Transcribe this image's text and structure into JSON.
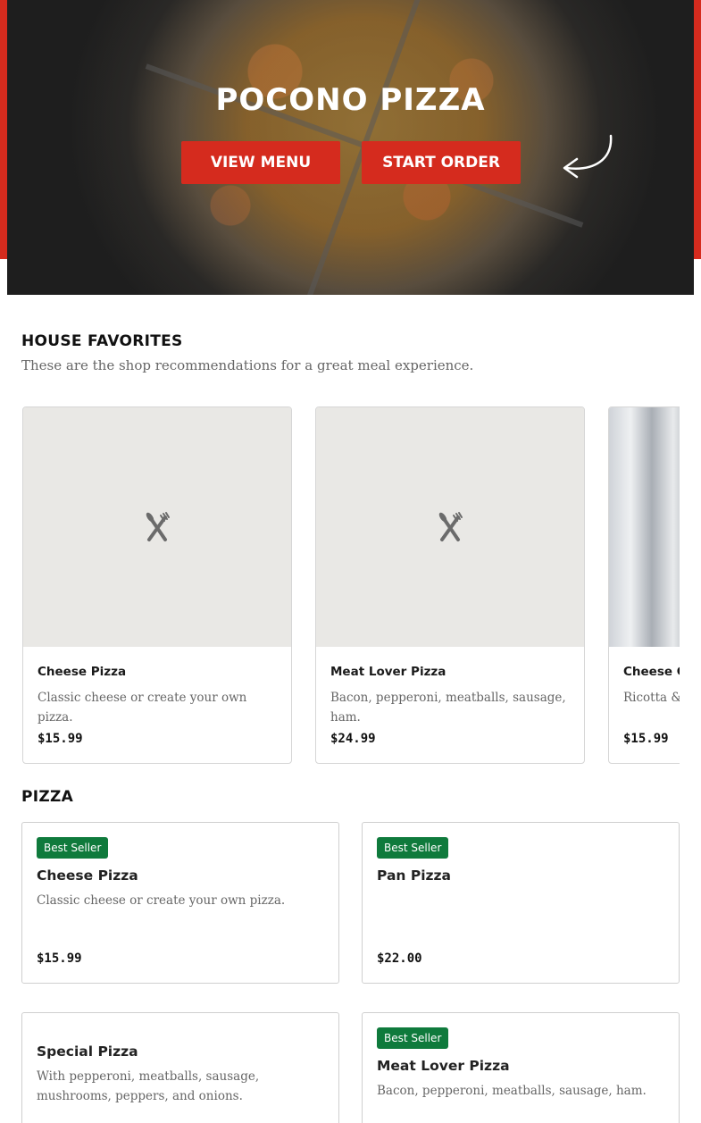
{
  "hero": {
    "title": "POCONO PIZZA",
    "view_menu_label": "VIEW MENU",
    "start_order_label": "START ORDER"
  },
  "house_favorites": {
    "title": "HOUSE FAVORITES",
    "subtitle": "These are the shop recommendations for a great meal experience.",
    "items": [
      {
        "name": "Cheese Pizza",
        "description": "Classic cheese or create your own pizza.",
        "price": "$15.99",
        "image": "placeholder-utensils-icon"
      },
      {
        "name": "Meat Lover Pizza",
        "description": "Bacon, pepperoni, meatballs, sausage, ham.",
        "price": "$24.99",
        "image": "placeholder-utensils-icon"
      },
      {
        "name": "Cheese C",
        "description": "Ricotta &",
        "price": "$15.99",
        "image": "photo"
      }
    ]
  },
  "pizza": {
    "title": "PIZZA",
    "items": [
      {
        "badge": "Best Seller",
        "name": "Cheese Pizza",
        "description": "Classic cheese or create your own pizza.",
        "price": "$15.99"
      },
      {
        "badge": "Best Seller",
        "name": "Pan Pizza",
        "description": "",
        "price": "$22.00"
      },
      {
        "badge": "",
        "name": "Special Pizza",
        "description": "With pepperoni, meatballs, sausage, mushrooms, peppers, and onions.",
        "price": ""
      },
      {
        "badge": "Best Seller",
        "name": "Meat Lover Pizza",
        "description": "Bacon, pepperoni, meatballs, sausage, ham.",
        "price": ""
      }
    ]
  },
  "colors": {
    "brand_red": "#d52b1e",
    "badge_green": "#0f7a3c"
  }
}
